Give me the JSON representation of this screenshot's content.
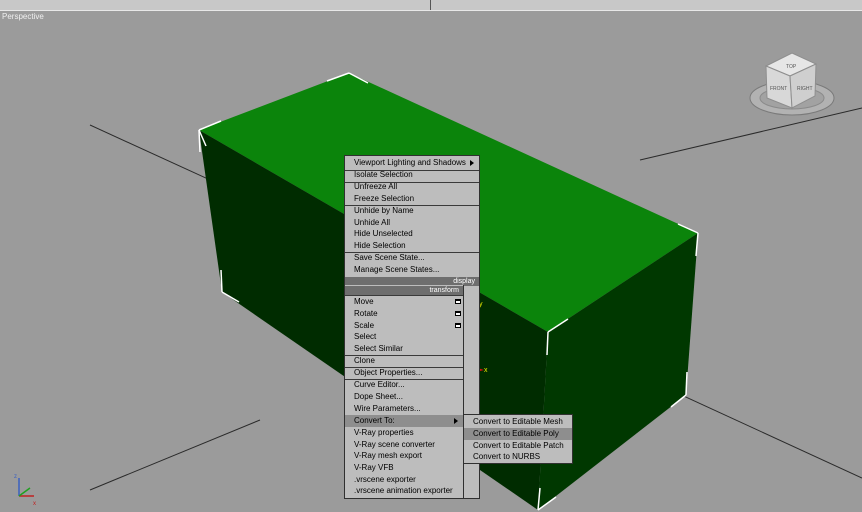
{
  "viewport": {
    "label": "Perspective"
  },
  "viewcube": {
    "top": "TOP",
    "front": "FRONT",
    "right": "RIGHT"
  },
  "axes": {
    "x": "x",
    "y": "y"
  },
  "colors": {
    "box_top": "#0b840b",
    "box_side": "#002c00",
    "menu_bg": "#bdbdbd",
    "menu_header": "#6e6e6e"
  },
  "display_menu": {
    "items": [
      "Viewport Lighting and Shadows",
      "Isolate Selection",
      "Unfreeze All",
      "Freeze Selection",
      "Unhide by Name",
      "Unhide All",
      "Hide Unselected",
      "Hide Selection",
      "Save Scene State...",
      "Manage Scene States..."
    ],
    "header": "display"
  },
  "transform_menu": {
    "header": "transform",
    "items": [
      "Move",
      "Rotate",
      "Scale",
      "Select",
      "Select Similar",
      "Clone",
      "Object Properties...",
      "Curve Editor...",
      "Dope Sheet...",
      "Wire Parameters...",
      "Convert To:",
      "V-Ray properties",
      "V-Ray scene converter",
      "V-Ray mesh export",
      "V-Ray VFB",
      ".vrscene exporter",
      ".vrscene animation exporter"
    ]
  },
  "convert_submenu": {
    "items": [
      "Convert to Editable Mesh",
      "Convert to Editable Poly",
      "Convert to Editable Patch",
      "Convert to NURBS"
    ]
  }
}
